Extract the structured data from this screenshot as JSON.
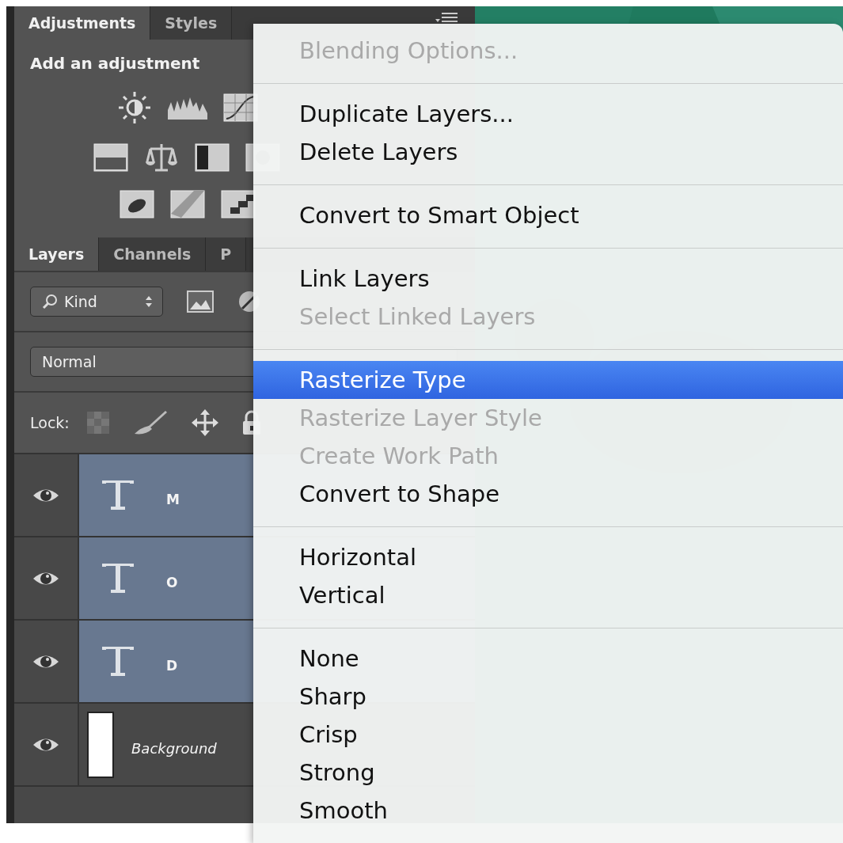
{
  "adjustments_panel": {
    "tabs": [
      {
        "label": "Adjustments",
        "selected": true
      },
      {
        "label": "Styles",
        "selected": false
      }
    ],
    "heading": "Add an adjustment"
  },
  "layers_panel": {
    "tabs": [
      {
        "label": "Layers",
        "selected": true
      },
      {
        "label": "Channels",
        "selected": false
      },
      {
        "label": "P",
        "selected": false
      }
    ],
    "filter": {
      "value": "Kind"
    },
    "blend_mode": {
      "value": "Normal"
    },
    "lock_label": "Lock:",
    "layers": [
      {
        "name": "M",
        "kind": "text",
        "selected": true
      },
      {
        "name": "O",
        "kind": "text",
        "selected": true
      },
      {
        "name": "D",
        "kind": "text",
        "selected": true
      },
      {
        "name": "Background",
        "kind": "background",
        "selected": false
      }
    ]
  },
  "context_menu": {
    "groups": [
      {
        "items": [
          {
            "label": "Blending Options...",
            "disabled": true,
            "selected": false
          }
        ]
      },
      {
        "items": [
          {
            "label": "Duplicate Layers...",
            "disabled": false,
            "selected": false
          },
          {
            "label": "Delete Layers",
            "disabled": false,
            "selected": false
          }
        ]
      },
      {
        "items": [
          {
            "label": "Convert to Smart Object",
            "disabled": false,
            "selected": false
          }
        ]
      },
      {
        "items": [
          {
            "label": "Link Layers",
            "disabled": false,
            "selected": false
          },
          {
            "label": "Select Linked Layers",
            "disabled": true,
            "selected": false
          }
        ]
      },
      {
        "items": [
          {
            "label": "Rasterize Type",
            "disabled": false,
            "selected": true
          },
          {
            "label": "Rasterize Layer Style",
            "disabled": true,
            "selected": false
          },
          {
            "label": "Create Work Path",
            "disabled": true,
            "selected": false
          },
          {
            "label": "Convert to Shape",
            "disabled": false,
            "selected": false
          }
        ]
      },
      {
        "items": [
          {
            "label": "Horizontal",
            "disabled": false,
            "selected": false
          },
          {
            "label": "Vertical",
            "disabled": false,
            "selected": false
          }
        ]
      },
      {
        "items": [
          {
            "label": "None",
            "disabled": false,
            "selected": false
          },
          {
            "label": "Sharp",
            "disabled": false,
            "selected": false
          },
          {
            "label": "Crisp",
            "disabled": false,
            "selected": false
          },
          {
            "label": "Strong",
            "disabled": false,
            "selected": false
          },
          {
            "label": "Smooth",
            "disabled": false,
            "selected": false
          }
        ]
      }
    ]
  }
}
